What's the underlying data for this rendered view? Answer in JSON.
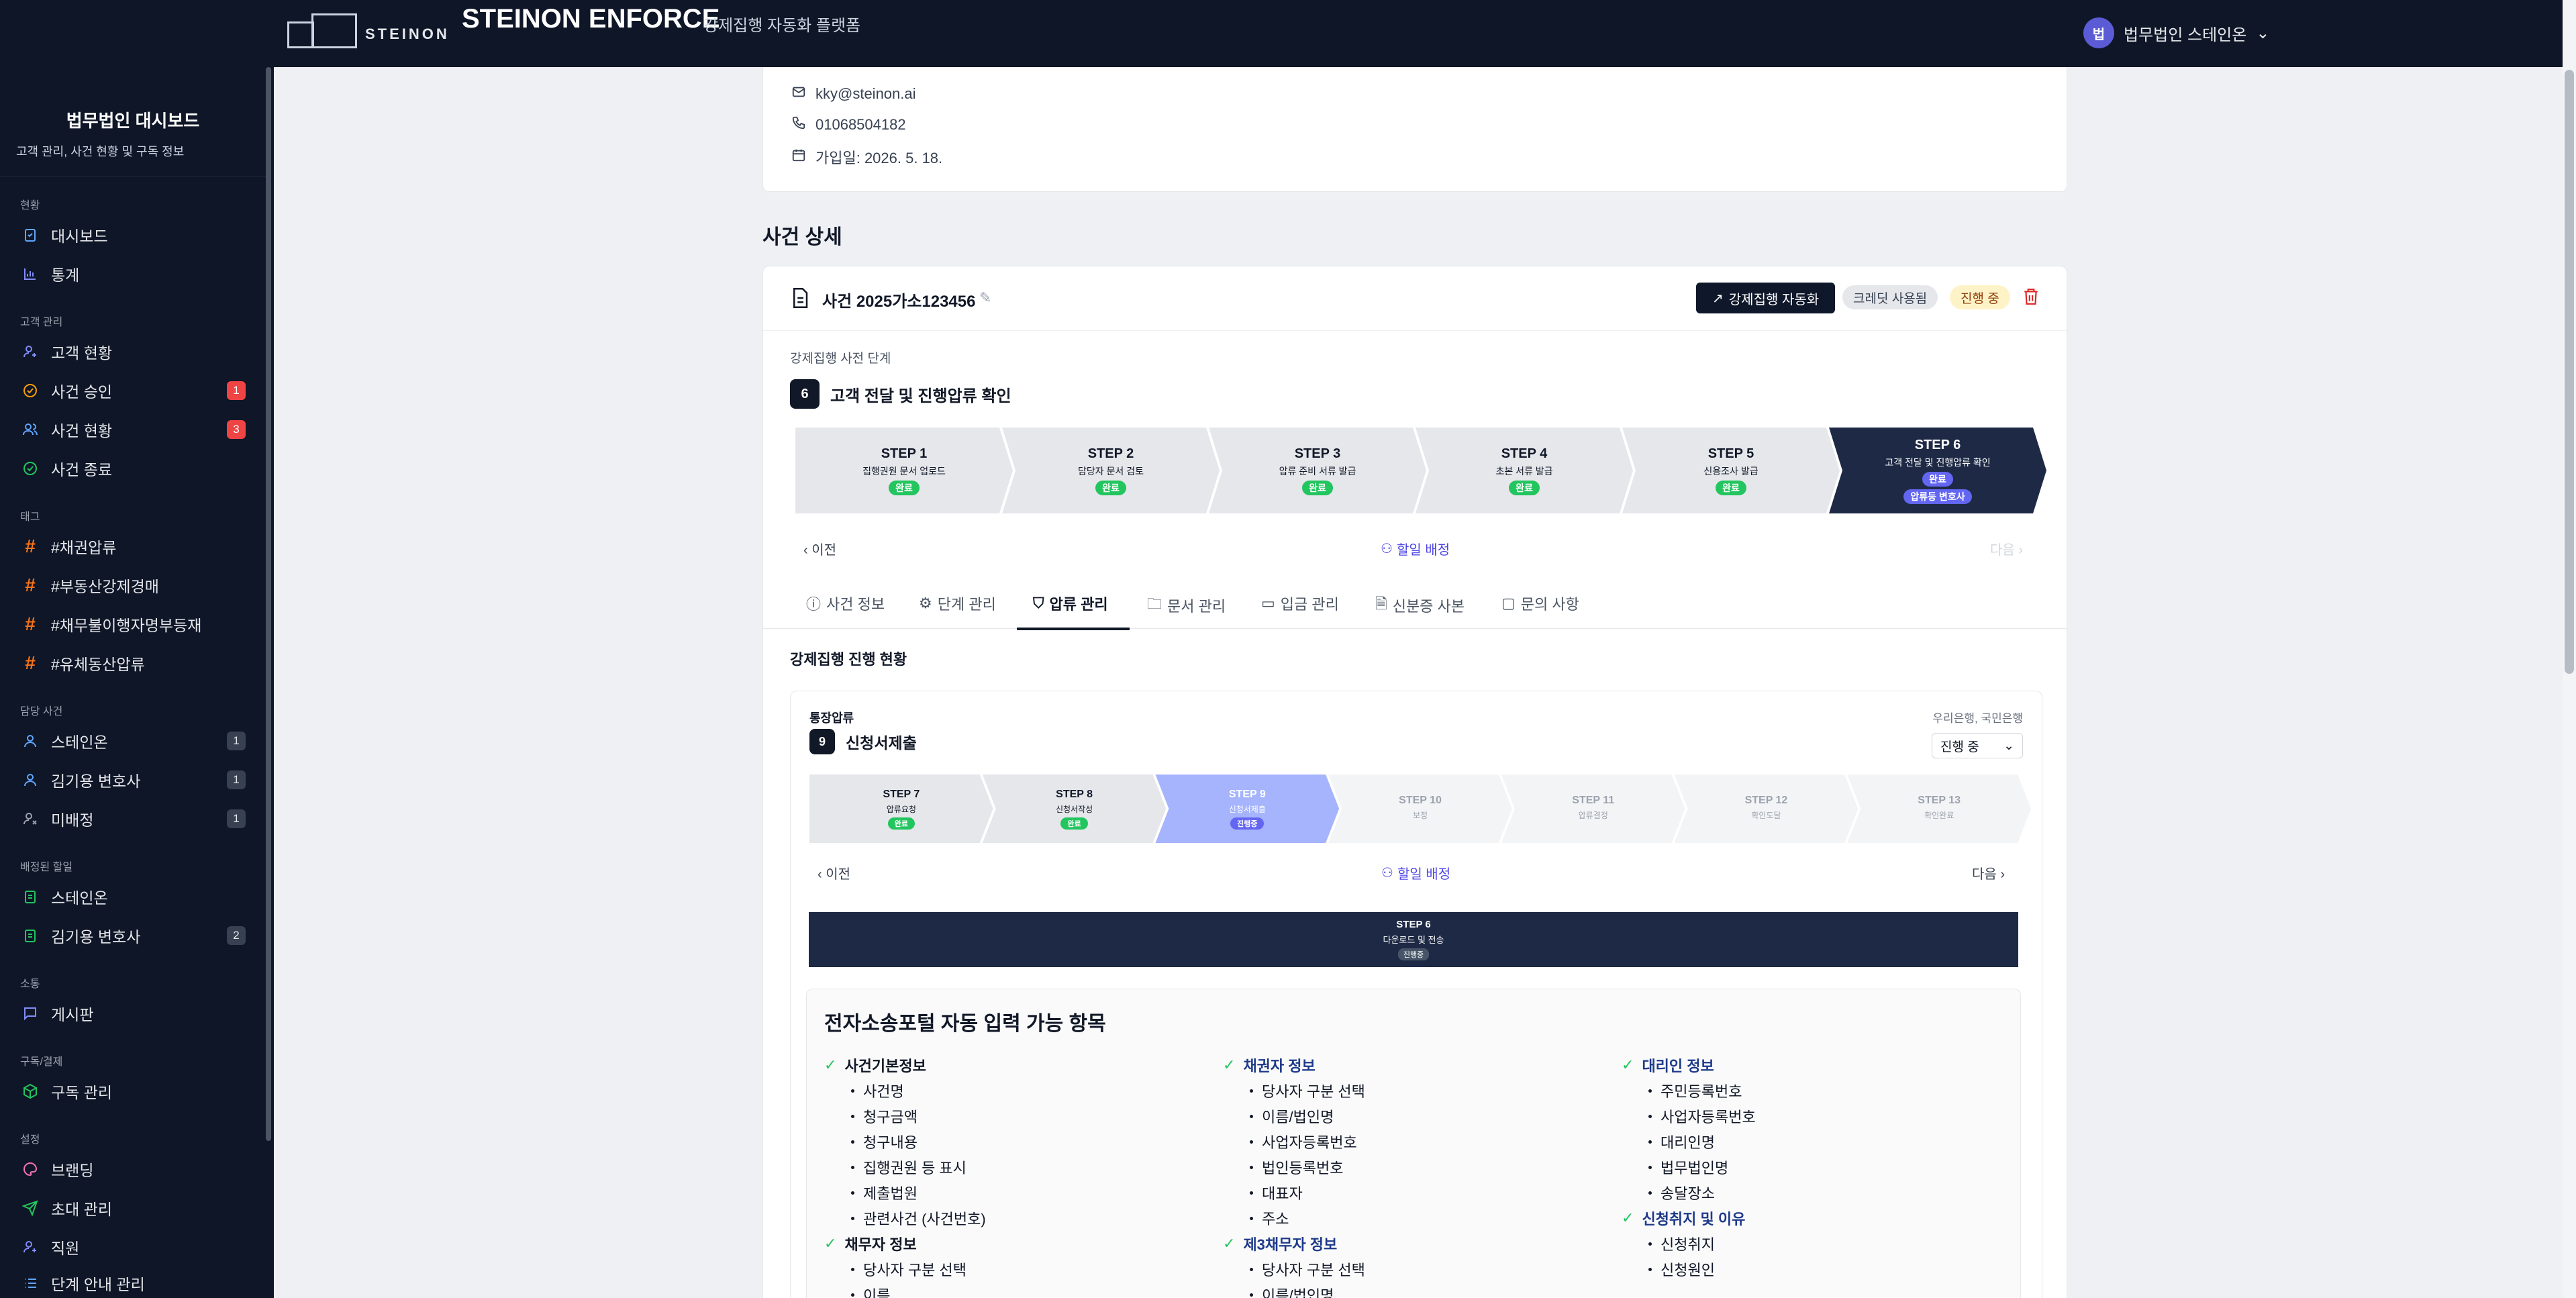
{
  "topbar": {
    "logo_text": "STEINON",
    "brand": "STEINON ENFORCE",
    "brand_sub": "강제집행 자동화 플랫폼",
    "user_initial": "법",
    "user_name": "법무법인 스테인온"
  },
  "sidebar": {
    "title": "법무법인 대시보드",
    "subtitle": "고객 관리, 사건 현황 및 구독 정보",
    "sections": {
      "status": "현황",
      "client": "고객 관리",
      "tags": "태그",
      "assigned_cases": "담당 사건",
      "assigned_sales": "배정된 할일",
      "comm": "소통",
      "billing": "구독/결제",
      "settings": "설정"
    },
    "items": {
      "dashboard": "대시보드",
      "stats": "통계",
      "clients": "고객 현황",
      "case_approval": "사건 승인",
      "case_approval_badge": "1",
      "case_status": "사건 현황",
      "case_status_badge": "3",
      "case_done": "사건 종료",
      "tag1": "#채권압류",
      "tag2": "#부동산강제경매",
      "tag3": "#채무불이행자명부등재",
      "tag4": "#유체동산압류",
      "assignee1": "스테인온",
      "assignee1_badge": "1",
      "assignee2": "김기용 변호사",
      "assignee2_badge": "1",
      "unassigned": "미배정",
      "unassigned_badge": "1",
      "sales1": "스테인온",
      "sales2": "김기용 변호사",
      "sales2_badge": "2",
      "board": "게시판",
      "subscription": "구독 관리",
      "branding": "브랜딩",
      "invite": "초대 관리",
      "staff": "직원",
      "guide": "단계 안내 관리"
    }
  },
  "contact": {
    "email": "kky@steinon.ai",
    "phone": "01068504182",
    "joined": "가입일: 2026. 5. 18."
  },
  "main": {
    "section_title": "사건 상세",
    "case_name": "사건 2025가소123456",
    "auto_button": "강제집행 자동화",
    "credit_pill": "크레딧 사용됨",
    "status_pill": "진행 중",
    "stage_label": "강제집행 사전 단계",
    "stage_num": "6",
    "stage_name": "고객 전달 및 진행압류 확인",
    "prev": "이전",
    "next": "다음",
    "assign": "할일 배정",
    "steps": [
      {
        "t": "STEP 1",
        "s": "집행권원 문서 업로드",
        "chip": "완료"
      },
      {
        "t": "STEP 2",
        "s": "담당자 문서 검토",
        "chip": "완료"
      },
      {
        "t": "STEP 3",
        "s": "압류 준비 서류 발급",
        "chip": "완료"
      },
      {
        "t": "STEP 4",
        "s": "초본 서류 발급",
        "chip": "완료"
      },
      {
        "t": "STEP 5",
        "s": "신용조사 발급",
        "chip": "완료"
      },
      {
        "t": "STEP 6",
        "s": "고객 전달 및 진행압류 확인",
        "chip": "완료",
        "chip2": "압류등 변호사"
      }
    ],
    "tabs": [
      "사건 정보",
      "단계 관리",
      "압류 관리",
      "문서 관리",
      "입금 관리",
      "신분증 사본",
      "문의 사항"
    ],
    "sub_title": "강제집행 진행 현황",
    "inner": {
      "kind": "통장압류",
      "banks": "우리은행, 국민은행",
      "num": "9",
      "name": "신청서제출",
      "select": "진행 중",
      "steps": [
        {
          "t": "STEP 7",
          "s": "압류요청",
          "chip": "완료"
        },
        {
          "t": "STEP 8",
          "s": "신청서작성",
          "chip": "완료"
        },
        {
          "t": "STEP 9",
          "s": "신청서제출",
          "chip": "진행중"
        },
        {
          "t": "STEP 10",
          "s": "보정",
          "chip": ""
        },
        {
          "t": "STEP 11",
          "s": "압류결정",
          "chip": ""
        },
        {
          "t": "STEP 12",
          "s": "확인도달",
          "chip": ""
        },
        {
          "t": "STEP 13",
          "s": "확인완료",
          "chip": ""
        }
      ],
      "banner_t": "STEP 6",
      "banner_s": "다운로드 및 전송",
      "banner_chip": "진행중"
    },
    "portal": {
      "title": "전자소송포털 자동 입력 가능 항목",
      "col1": {
        "g1": "사건기본정보",
        "g1_items": [
          "사건명",
          "청구금액",
          "청구내용",
          "집행권원 등 표시",
          "제출법원",
          "관련사건 (사건번호)"
        ],
        "g2": "채무자 정보",
        "g2_items": [
          "당사자 구분 선택",
          "이름"
        ]
      },
      "col2": {
        "g1": "채권자 정보",
        "g1_items": [
          "당사자 구분 선택",
          "이름/법인명",
          "사업자등록번호",
          "법인등록번호",
          "대표자",
          "주소"
        ],
        "g2": "제3채무자 정보",
        "g2_items": [
          "당사자 구분 선택",
          "이름/법인명"
        ]
      },
      "col3": {
        "g1": "대리인 정보",
        "g1_items": [
          "주민등록번호",
          "사업자등록번호",
          "대리인명",
          "법무법인명",
          "송달장소"
        ],
        "g2": "신청취지 및 이유",
        "g2_items": [
          "신청취지",
          "신청원인"
        ]
      }
    }
  }
}
